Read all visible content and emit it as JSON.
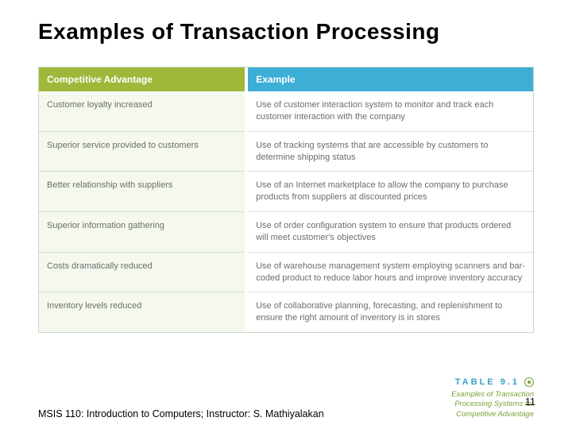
{
  "title": "Examples of Transaction Processing",
  "table": {
    "headers": {
      "left": "Competitive Advantage",
      "right": "Example"
    },
    "rows": [
      {
        "left": "Customer loyalty increased",
        "right": "Use of customer interaction system to monitor and track each customer interaction with the company"
      },
      {
        "left": "Superior service provided to customers",
        "right": "Use of tracking systems that are accessible by customers to determine shipping status"
      },
      {
        "left": "Better relationship with suppliers",
        "right": "Use of an Internet marketplace to allow the company to purchase products from suppliers at discounted prices"
      },
      {
        "left": "Superior information gathering",
        "right": "Use of order configuration system to ensure that products ordered will meet customer's objectives"
      },
      {
        "left": "Costs dramatically reduced",
        "right": "Use of warehouse management system employing scanners and bar-coded product to reduce labor hours and improve inventory accuracy"
      },
      {
        "left": "Inventory levels reduced",
        "right": "Use of collaborative planning, forecasting, and replenishment to ensure the right amount of inventory is in stores"
      }
    ]
  },
  "footer": {
    "left": "MSIS 110:  Introduction to Computers;  Instructor: S. Mathiyalakan",
    "table_label": "TABLE 9.1",
    "caption": "Examples of Transaction Processing Systems for Competitive Advantage",
    "page": "11"
  }
}
